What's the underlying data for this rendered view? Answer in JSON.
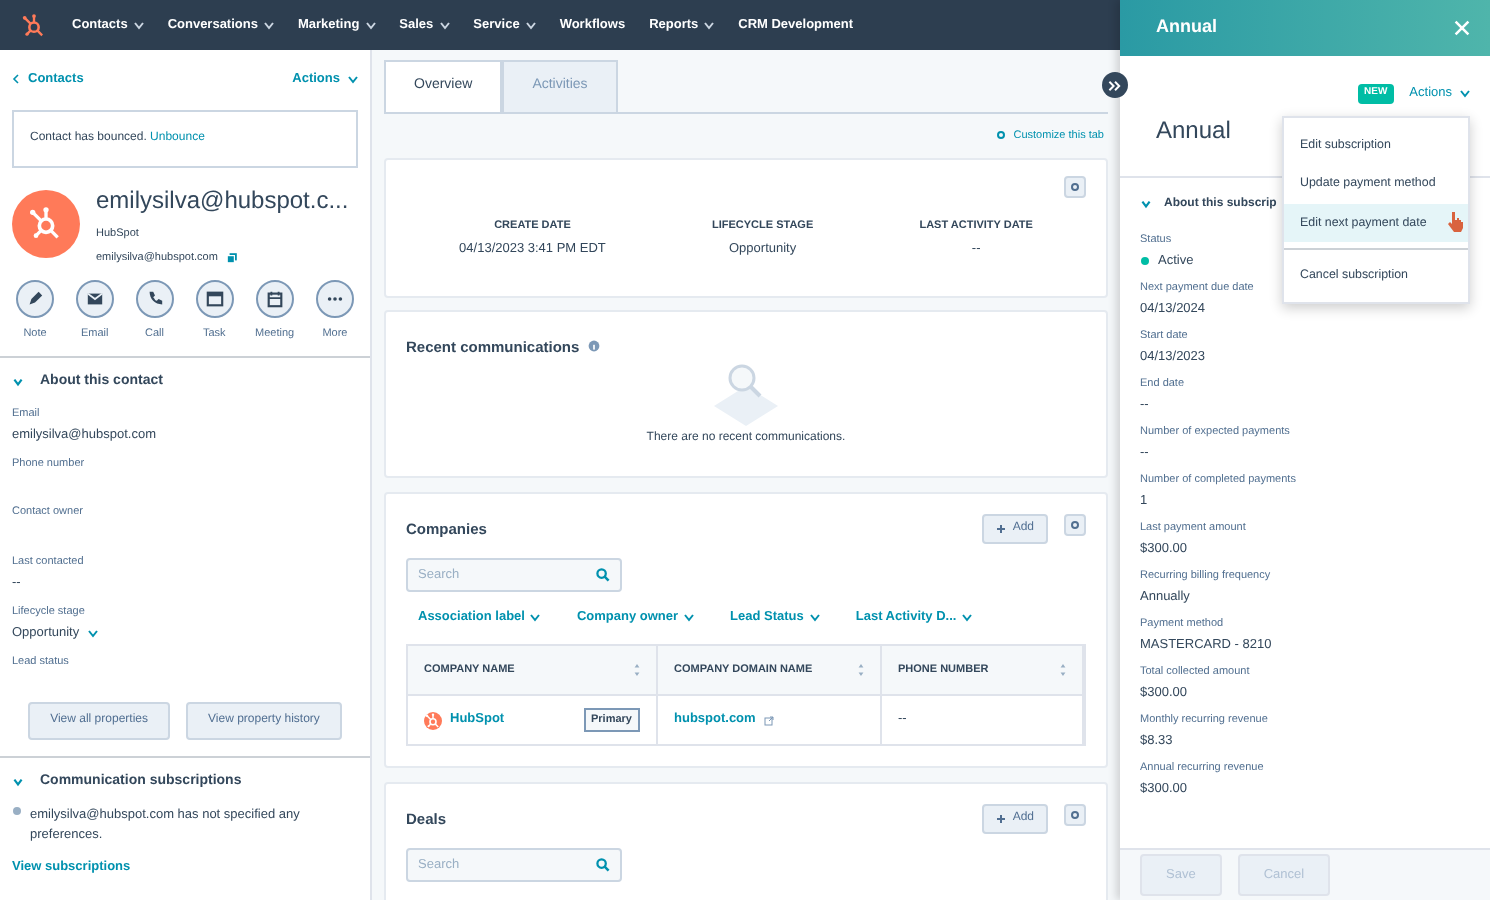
{
  "nav": {
    "items": [
      {
        "label": "Contacts",
        "dropdown": true
      },
      {
        "label": "Conversations",
        "dropdown": true
      },
      {
        "label": "Marketing",
        "dropdown": true
      },
      {
        "label": "Sales",
        "dropdown": true
      },
      {
        "label": "Service",
        "dropdown": true
      },
      {
        "label": "Workflows",
        "dropdown": false
      },
      {
        "label": "Reports",
        "dropdown": true
      },
      {
        "label": "CRM Development",
        "dropdown": false
      }
    ]
  },
  "contact": {
    "back_link": "Contacts",
    "actions": "Actions",
    "bounce_notice": "Contact has bounced.",
    "unbounce_link": "Unbounce",
    "name": "emilysilva@hubspot.c...",
    "company": "HubSpot",
    "email": "emilysilva@hubspot.com",
    "quick_actions": [
      {
        "label": "Note",
        "kind": "note"
      },
      {
        "label": "Email",
        "kind": "email"
      },
      {
        "label": "Call",
        "kind": "call"
      },
      {
        "label": "Task",
        "kind": "task"
      },
      {
        "label": "Meeting",
        "kind": "meeting"
      },
      {
        "label": "More",
        "kind": "more"
      }
    ]
  },
  "about": {
    "title": "About this contact",
    "expanded": true,
    "fields": [
      {
        "label": "Email",
        "value": "emilysilva@hubspot.com",
        "kind": "text"
      },
      {
        "label": "Phone number",
        "kind": "text"
      },
      {
        "label": "Contact owner",
        "kind": "text"
      },
      {
        "label": "Last contacted",
        "value": "--",
        "kind": "text"
      },
      {
        "label": "Lifecycle stage",
        "value": "Opportunity",
        "kind": "dropdown"
      },
      {
        "label": "Lead status",
        "kind": "text"
      }
    ],
    "buttons": [
      "View all properties",
      "View property history"
    ]
  },
  "subscriptions": {
    "title": "Communication subscriptions",
    "expanded": true,
    "text": "emilysilva@hubspot.com has not specified any preferences.",
    "link": "View subscriptions"
  },
  "tabs": [
    {
      "label": "Overview",
      "selected": true
    },
    {
      "label": "Activities",
      "selected": false
    }
  ],
  "customize_link": "Customize this tab",
  "summary": [
    {
      "label": "CREATE DATE",
      "value": "04/13/2023 3:41 PM EDT"
    },
    {
      "label": "LIFECYCLE STAGE",
      "value": "Opportunity"
    },
    {
      "label": "LAST ACTIVITY DATE",
      "value": "--"
    }
  ],
  "recent_communications": {
    "title": "Recent communications",
    "empty_text": "There are no recent communications."
  },
  "companies": {
    "title": "Companies",
    "add_button": "Add",
    "search_placeholder": "Search",
    "filters": [
      "Association label",
      "Company owner",
      "Lead Status",
      "Last Activity D..."
    ],
    "columns": [
      "COMPANY NAME",
      "COMPANY DOMAIN NAME",
      "PHONE NUMBER"
    ],
    "rows": [
      {
        "name": "HubSpot",
        "badge": "Primary",
        "domain": "hubspot.com",
        "phone": "--"
      }
    ]
  },
  "deals": {
    "title": "Deals",
    "add_button": "Add",
    "search_placeholder": "Search"
  },
  "panel": {
    "header_title": "Annual",
    "badge": "NEW",
    "actions": "Actions",
    "title": "Annual",
    "section_title": "About this subscrip",
    "section_expanded": true,
    "menu": [
      {
        "label": "Edit subscription",
        "selected": false,
        "divider_before": false
      },
      {
        "label": "Update payment method",
        "selected": false,
        "divider_before": false
      },
      {
        "label": "Edit next payment date",
        "selected": true,
        "divider_before": false
      },
      {
        "label": "Cancel subscription",
        "selected": false,
        "divider_before": true
      }
    ],
    "fields": [
      {
        "label": "Status",
        "value": "Active",
        "kind": "status"
      },
      {
        "label": "Next payment due date",
        "value": "04/13/2024",
        "kind": "text"
      },
      {
        "label": "Start date",
        "value": "04/13/2023",
        "kind": "text"
      },
      {
        "label": "End date",
        "value": "--",
        "kind": "text"
      },
      {
        "label": "Number of expected payments",
        "value": "--",
        "kind": "text"
      },
      {
        "label": "Number of completed payments",
        "value": "1",
        "kind": "text"
      },
      {
        "label": "Last payment amount",
        "value": "$300.00",
        "kind": "text"
      },
      {
        "label": "Recurring billing frequency",
        "value": "Annually",
        "kind": "text"
      },
      {
        "label": "Payment method",
        "value": "MASTERCARD - 8210",
        "kind": "text"
      },
      {
        "label": "Total collected amount",
        "value": "$300.00",
        "kind": "text"
      },
      {
        "label": "Monthly recurring revenue",
        "value": "$8.33",
        "kind": "text"
      },
      {
        "label": "Annual recurring revenue",
        "value": "$300.00",
        "kind": "text"
      }
    ],
    "footer_buttons": [
      {
        "label": "Save",
        "disabled": true
      },
      {
        "label": "Cancel",
        "disabled": true
      }
    ]
  }
}
